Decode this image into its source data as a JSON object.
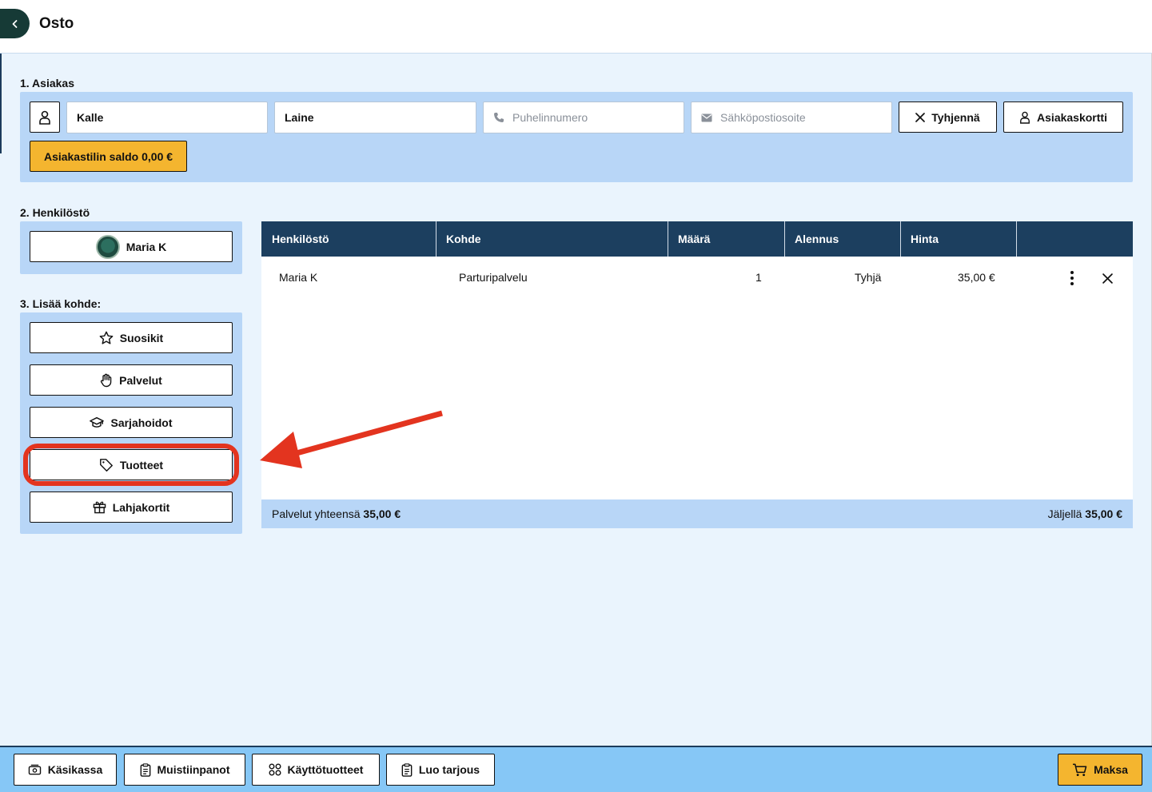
{
  "header": {
    "title": "Osto"
  },
  "customer": {
    "section_label": "1. Asiakas",
    "first_name": "Kalle",
    "last_name": "Laine",
    "phone_placeholder": "Puhelinnumero",
    "email_placeholder": "Sähköpostiosoite",
    "clear_label": "Tyhjennä",
    "card_label": "Asiakaskortti",
    "balance_label": "Asiakastilin saldo 0,00 €"
  },
  "staff": {
    "section_label": "2. Henkilöstö",
    "selected_name": "Maria K"
  },
  "add_item": {
    "section_label": "3. Lisää kohde:",
    "buttons": [
      "Suosikit",
      "Palvelut",
      "Sarjahoidot",
      "Tuotteet",
      "Lahjakortit"
    ]
  },
  "table": {
    "columns": [
      "Henkilöstö",
      "Kohde",
      "Määrä",
      "Alennus",
      "Hinta"
    ],
    "rows": [
      {
        "staff": "Maria K",
        "item": "Parturipalvelu",
        "qty": "1",
        "discount": "Tyhjä",
        "price": "35,00 €"
      }
    ],
    "footer": {
      "total_label": "Palvelut yhteensä",
      "total_value": "35,00 €",
      "remaining_label": "Jäljellä",
      "remaining_value": "35,00 €"
    }
  },
  "bottombar": {
    "buttons": [
      "Käsikassa",
      "Muistiinpanot",
      "Käyttötuotteet",
      "Luo tarjous"
    ],
    "pay_label": "Maksa"
  },
  "colors": {
    "header_navy": "#1c3f5f",
    "panel_blue": "#b8d6f7",
    "accent_yellow": "#f4b52f",
    "highlight_red": "#e3341f"
  }
}
